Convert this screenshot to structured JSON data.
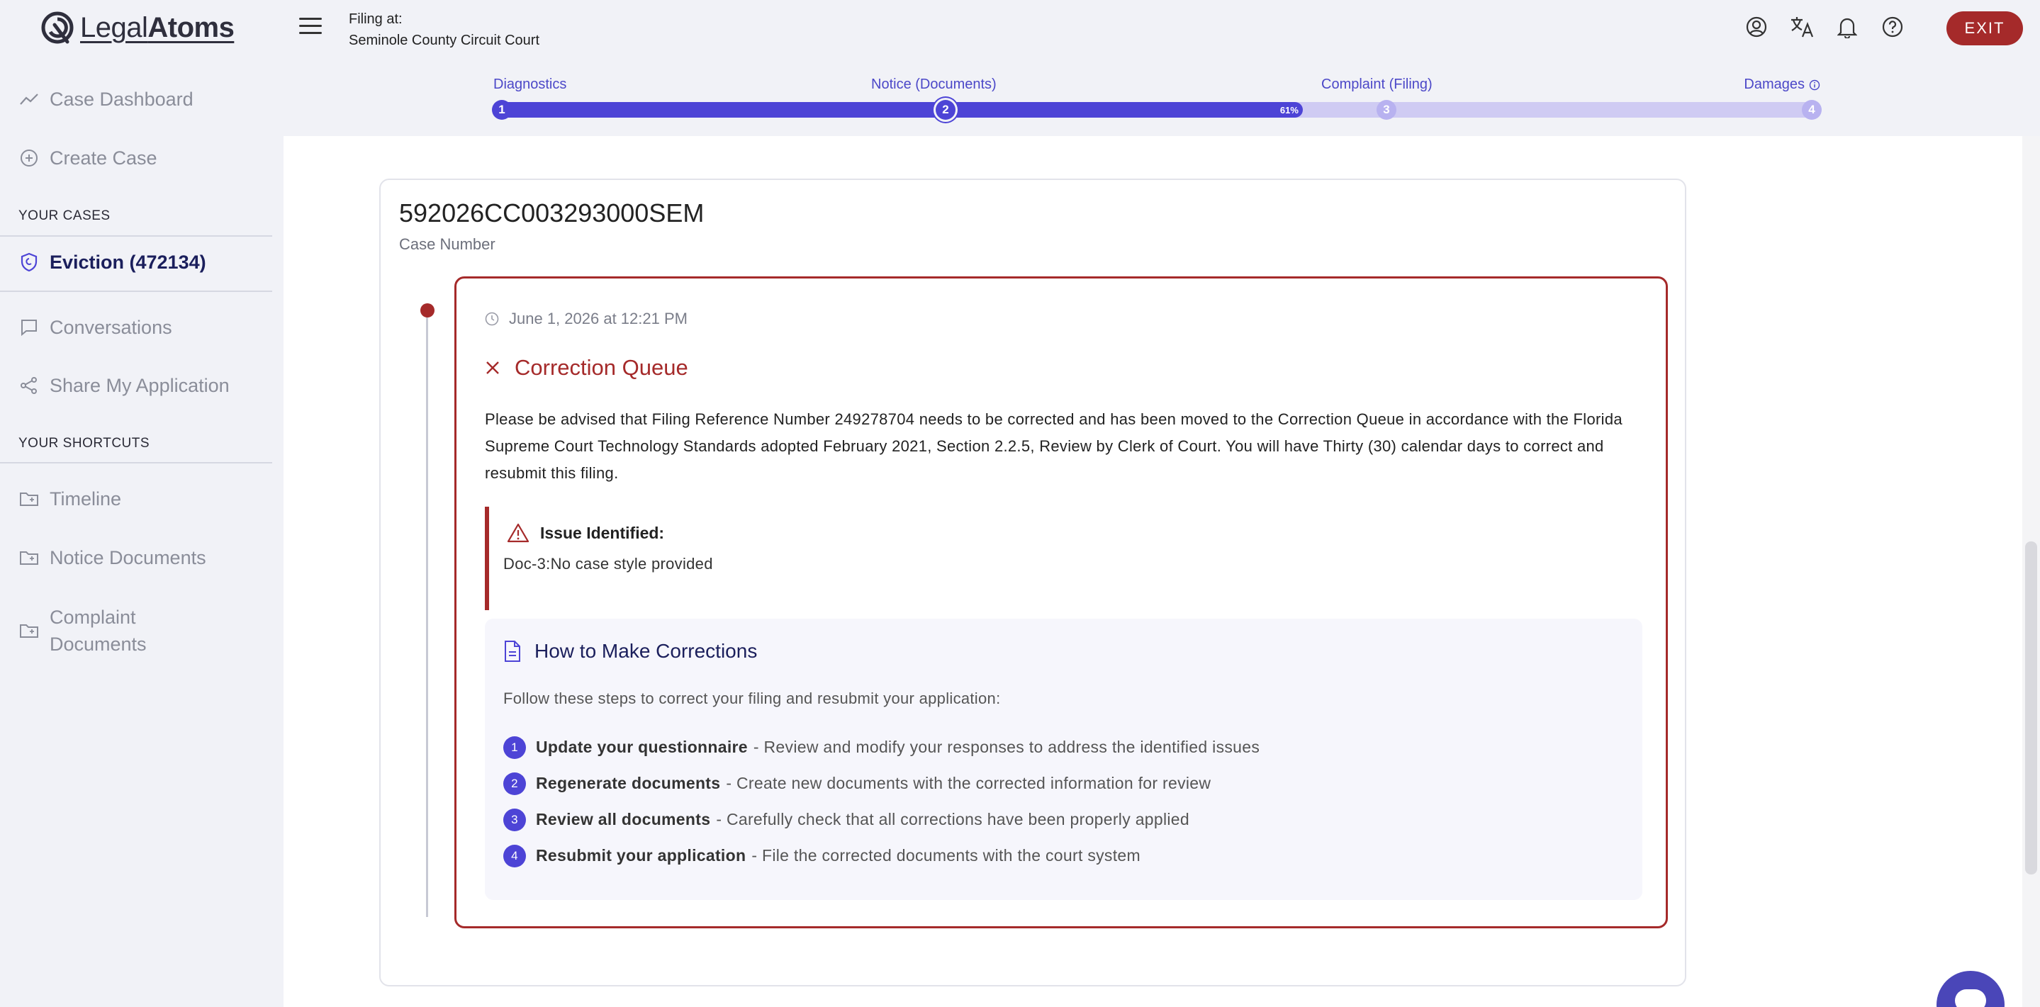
{
  "header": {
    "logo_prefix": "Legal",
    "logo_bold": "Atoms",
    "filing_label": "Filing at:",
    "filing_court": "Seminole County Circuit Court",
    "icons": [
      "account-icon",
      "translate-icon",
      "bell-icon",
      "help-icon"
    ],
    "exit_label": "EXIT"
  },
  "sidebar": {
    "case_dashboard": "Case Dashboard",
    "create_case": "Create Case",
    "your_cases_label": "YOUR CASES",
    "active_case": "Eviction (472134)",
    "conversations": "Conversations",
    "share": "Share My Application",
    "shortcuts_label": "YOUR SHORTCUTS",
    "timeline": "Timeline",
    "notice_docs": "Notice Documents",
    "complaint_docs_1": "Complaint",
    "complaint_docs_2": "Documents"
  },
  "progress": {
    "steps": [
      {
        "label": "Diagnostics",
        "num": "1"
      },
      {
        "label": "Notice (Documents)",
        "num": "2"
      },
      {
        "label": "Complaint (Filing)",
        "num": "3"
      },
      {
        "label": "Damages",
        "num": "4"
      }
    ],
    "percent": 61,
    "percent_label": "61%"
  },
  "case": {
    "number": "592026CC003293000SEM",
    "number_label": "Case Number"
  },
  "event": {
    "timestamp": "June 1, 2026 at 12:21 PM",
    "title": "Correction Queue",
    "message": "Please be advised that Filing Reference Number 249278704 needs to be corrected and has been moved to the Correction Queue in accordance with the Florida Supreme Court Technology Standards adopted February 2021, Section 2.2.5, Review by Clerk of Court. You will have Thirty (30) calendar days to correct and resubmit this filing.",
    "issue_heading": "Issue Identified:",
    "issue_text": "Doc-3:No case style provided"
  },
  "corrections": {
    "heading": "How to Make Corrections",
    "intro": "Follow these steps to correct your filing and resubmit your application:",
    "steps": [
      {
        "num": "1",
        "title": "Update your questionnaire",
        "desc": "- Review and modify your responses to address the identified issues"
      },
      {
        "num": "2",
        "title": "Regenerate documents",
        "desc": "- Create new documents with the corrected information for review"
      },
      {
        "num": "3",
        "title": "Review all documents",
        "desc": "- Carefully check that all corrections have been properly applied"
      },
      {
        "num": "4",
        "title": "Resubmit your application",
        "desc": "- File the corrected documents with the court system"
      }
    ]
  },
  "colors": {
    "accent": "#4d44d6",
    "danger": "#a52a2a",
    "background": "#f1f2f7"
  }
}
